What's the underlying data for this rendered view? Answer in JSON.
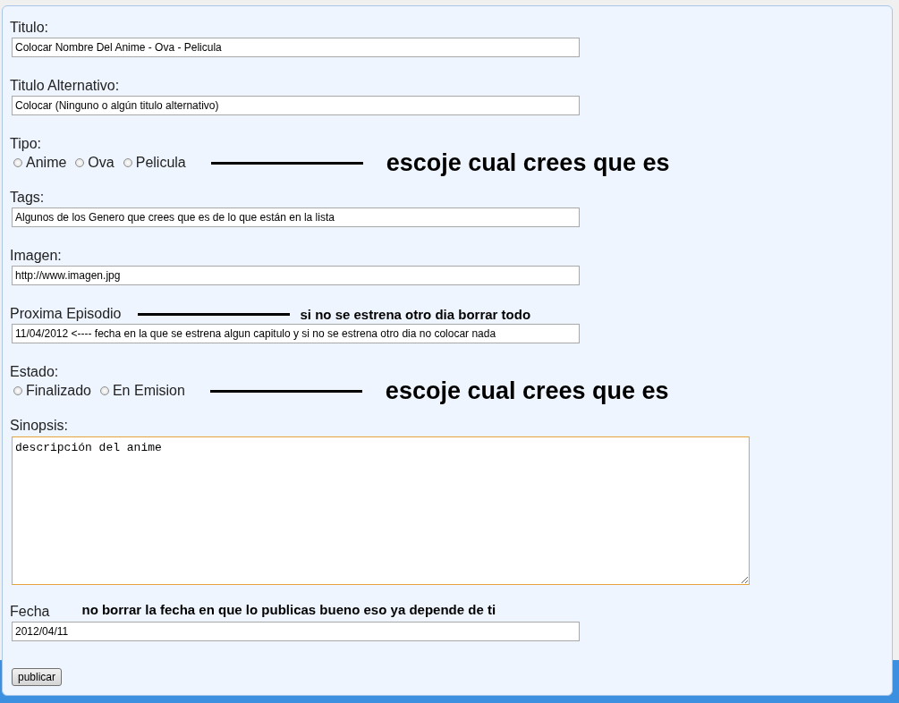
{
  "form": {
    "fields": [
      {
        "kind": "text",
        "label": "Titulo:",
        "value": "Colocar Nombre Del Anime - Ova - Pelicula"
      },
      {
        "kind": "text",
        "label": "Titulo Alternativo:",
        "value": "Colocar (Ninguno o algún titulo alternativo)"
      },
      {
        "kind": "radio",
        "label": "Tipo:",
        "options": [
          {
            "label": "Anime",
            "selected": false
          },
          {
            "label": "Ova",
            "selected": false
          },
          {
            "label": "Pelicula",
            "selected": false
          }
        ],
        "note": {
          "text": "escoje cual crees que es",
          "leader": true
        }
      },
      {
        "kind": "text",
        "label": "Tags:",
        "value": "Algunos de los Genero que crees que es de lo que están en la lista"
      },
      {
        "kind": "text",
        "label": "Imagen:",
        "value": "http://www.imagen.jpg"
      },
      {
        "kind": "text",
        "label": "Proxima Episodio",
        "value": "11/04/2012 <---- fecha en la que se estrena algun capitulo y si no se estrena otro dia no colocar nada",
        "note": {
          "text": "si no se estrena otro dia borrar todo",
          "leader": true
        }
      },
      {
        "kind": "radio",
        "label": "Estado:",
        "options": [
          {
            "label": "Finalizado",
            "selected": false
          },
          {
            "label": "En Emision",
            "selected": false
          }
        ],
        "note": {
          "text": "escoje cual crees que es",
          "leader": true
        }
      },
      {
        "kind": "textarea",
        "label": "Sinopsis:",
        "value": "descripción del anime",
        "focused": true
      },
      {
        "kind": "text",
        "label": "Fecha",
        "value": "2012/04/11",
        "note": {
          "text": "no borrar la fecha en que lo publicas bueno eso ya depende de ti",
          "leader": false
        }
      }
    ],
    "button": "publicar"
  }
}
